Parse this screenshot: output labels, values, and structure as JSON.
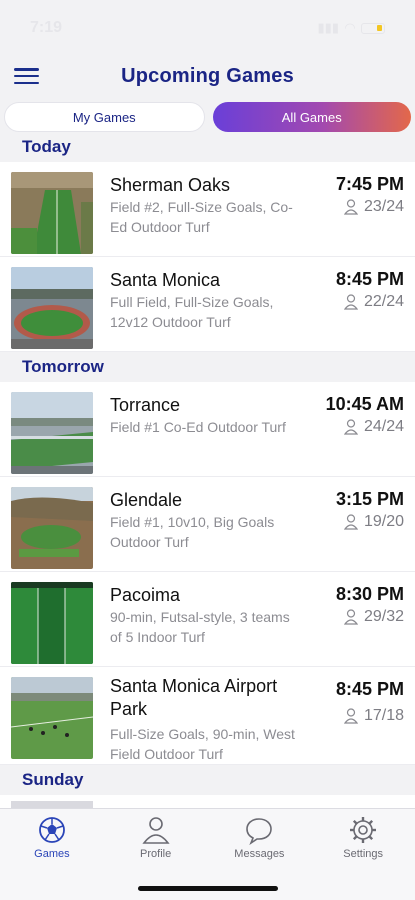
{
  "status": {
    "time": "7:19",
    "battery_color": "#f3c623"
  },
  "header": {
    "title": "Upcoming Games"
  },
  "segmented": {
    "my_games": "My Games",
    "all_games": "All Games",
    "selected": "All Games"
  },
  "sections": {
    "today": "Today",
    "tomorrow": "Tomorrow",
    "sunday": "Sunday"
  },
  "games": [
    {
      "name": "Sherman Oaks",
      "desc": "Field #2, Full-Size Goals, Co-Ed Outdoor Turf",
      "time": "7:45 PM",
      "count": "23/24"
    },
    {
      "name": "Santa Monica",
      "desc": "Full Field, Full-Size Goals, 12v12 Outdoor Turf",
      "time": "8:45 PM",
      "count": "22/24"
    },
    {
      "name": "Torrance",
      "desc": "Field #1 Co-Ed Outdoor Turf",
      "time": "10:45 AM",
      "count": "24/24"
    },
    {
      "name": "Glendale",
      "desc": "Field #1, 10v10, Big Goals Outdoor Turf",
      "time": "3:15 PM",
      "count": "19/20"
    },
    {
      "name": "Pacoima",
      "desc": "90-min, Futsal-style, 3 teams of 5 Indoor Turf",
      "time": "8:30 PM",
      "count": "29/32"
    },
    {
      "name": "Santa Monica Airport Park",
      "desc": "Full-Size Goals, 90-min, West Field Outdoor Turf",
      "time": "8:45 PM",
      "count": "17/18"
    }
  ],
  "tabs": [
    {
      "label": "Games",
      "icon": "soccer-ball-icon"
    },
    {
      "label": "Profile",
      "icon": "person-icon"
    },
    {
      "label": "Messages",
      "icon": "chat-bubble-icon"
    },
    {
      "label": "Settings",
      "icon": "gear-icon"
    }
  ],
  "colors": {
    "accent": "#1b2585",
    "tab_active": "#2b45b8",
    "gradient_start": "#6a3fd8",
    "gradient_end": "#e3684a"
  }
}
